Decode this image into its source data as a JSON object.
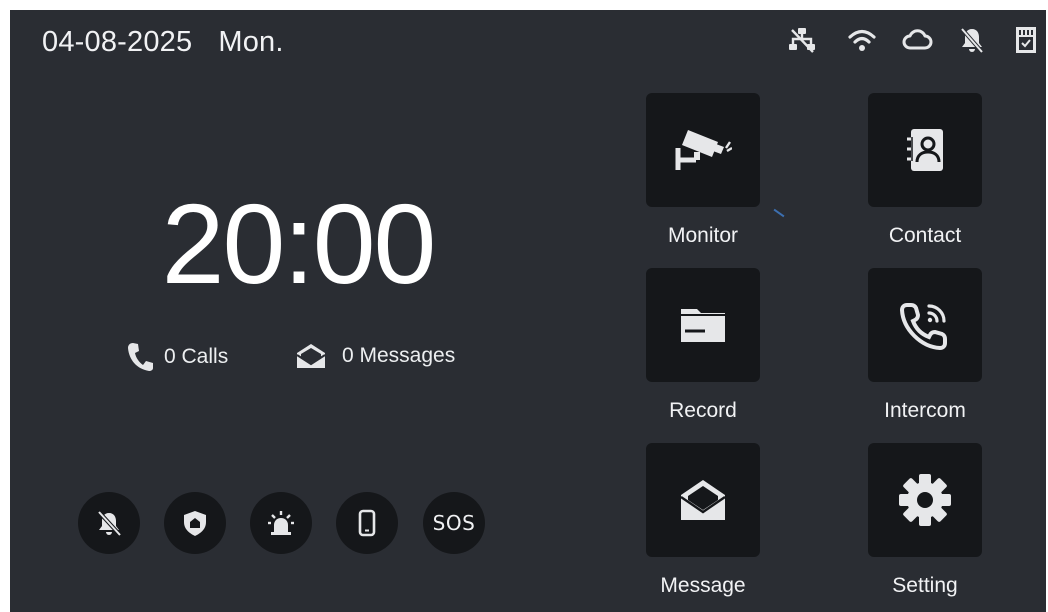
{
  "status_bar": {
    "date": "04-08-2025",
    "day": "Mon.",
    "icons": [
      "network-icon",
      "wifi-icon",
      "cloud-icon",
      "mute-icon",
      "sd-card-icon"
    ]
  },
  "clock": {
    "time": "20:00"
  },
  "counters": {
    "calls": "0 Calls",
    "messages": "0 Messages"
  },
  "quick_actions": [
    {
      "icon": "mute-bell-icon"
    },
    {
      "icon": "home-shield-icon"
    },
    {
      "icon": "alarm-light-icon"
    },
    {
      "icon": "mobile-phone-icon"
    },
    {
      "label": "SOS"
    }
  ],
  "apps": {
    "monitor": "Monitor",
    "contact": "Contact",
    "record": "Record",
    "intercom": "Intercom",
    "message": "Message",
    "setting": "Setting"
  },
  "colors": {
    "background": "#2a2d33",
    "tile": "#15171a",
    "text": "#f1f2f4",
    "icon": "#e6e7e9"
  }
}
